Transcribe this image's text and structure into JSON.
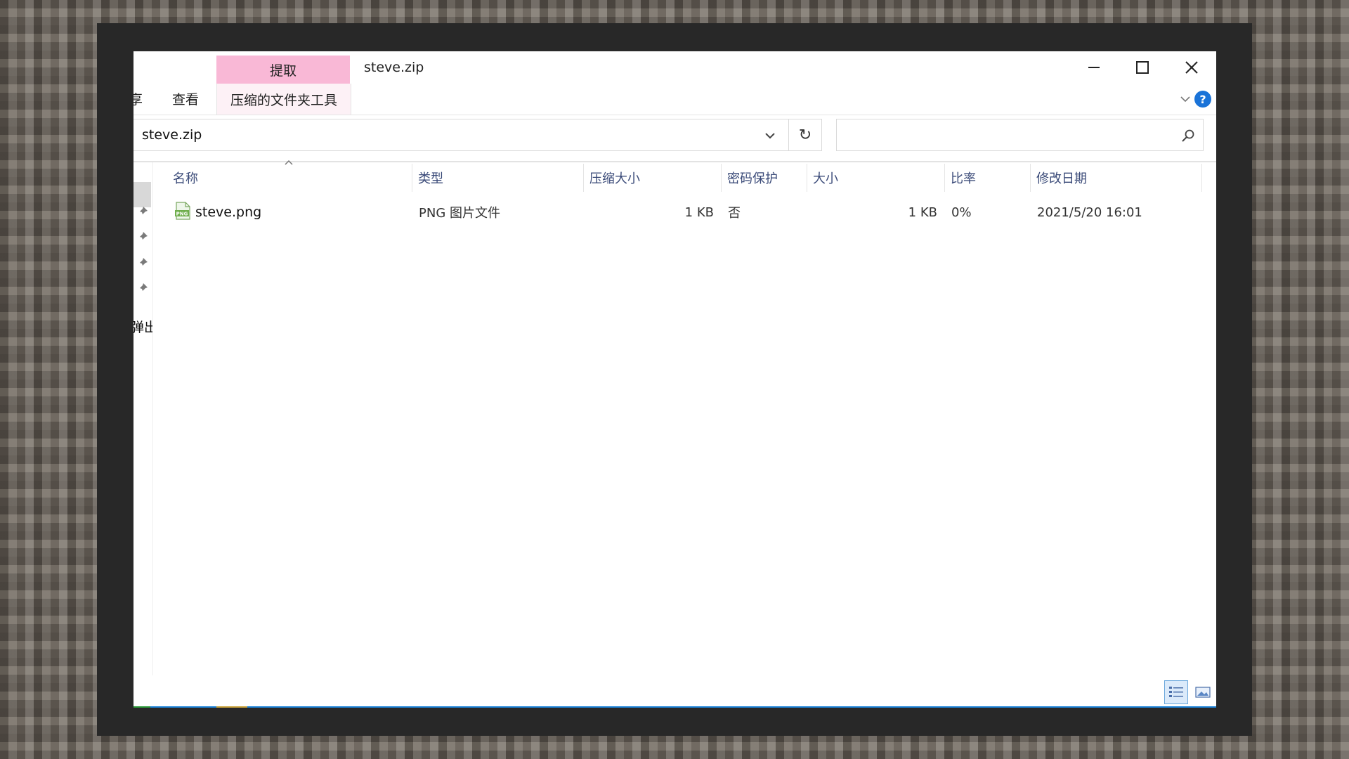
{
  "window": {
    "title": "steve.zip",
    "context_tab": "提取",
    "context_tool_label": "压缩的文件夹工具",
    "ribbon_tabs": [
      "享",
      "查看"
    ]
  },
  "address_bar": {
    "path": "steve.zip",
    "search_placeholder": ""
  },
  "nav_pane": {
    "eject_label": "弹出"
  },
  "table": {
    "columns": [
      "名称",
      "类型",
      "压缩大小",
      "密码保护",
      "大小",
      "比率",
      "修改日期"
    ],
    "rows": [
      {
        "name": "steve.png",
        "type": "PNG 图片文件",
        "compressed_size": "1 KB",
        "password_protected": "否",
        "size": "1 KB",
        "ratio": "0%",
        "modified": "2021/5/20 16:01"
      }
    ]
  },
  "colors": {
    "context_tab": "#f9b8d6",
    "context_tool": "#fdf1f6",
    "header_text": "#3a4a78",
    "help_button": "#1a73d8",
    "frame": "#282828"
  },
  "icons": {
    "file": "png-file-icon",
    "help": "help-icon",
    "refresh": "refresh-icon",
    "search": "search-icon"
  }
}
